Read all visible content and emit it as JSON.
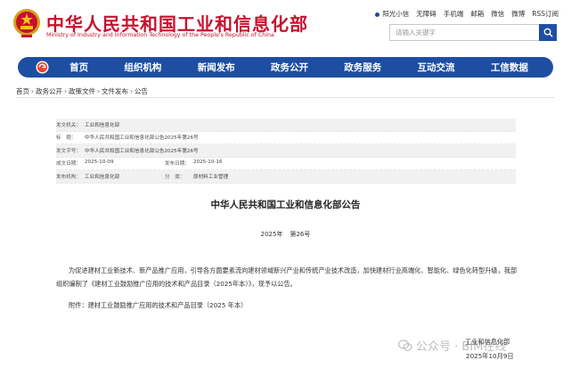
{
  "header": {
    "title_cn": "中华人民共和国工业和信息化部",
    "title_en": "Ministry of Industry and Information Technology of the People's Republic of China",
    "toplinks": [
      "阳光小信",
      "无障碍",
      "手机端",
      "邮箱",
      "微信",
      "微博",
      "RSS订阅"
    ],
    "search_placeholder": "请输入关键字"
  },
  "nav": {
    "items": [
      "首页",
      "组织机构",
      "新闻发布",
      "政务公开",
      "政务服务",
      "互动交流",
      "工信数据"
    ]
  },
  "breadcrumb": [
    "首页",
    "政务公开",
    "政策文件",
    "文件发布",
    "公告"
  ],
  "meta": {
    "issuer_label": "发文机关：",
    "issuer": "工业和信息化部",
    "title_label": "标　题：",
    "title": "中华人民共和国工业和信息化部公告2025年第26号",
    "docno_label": "发文字号：",
    "docno": "中华人民共和国工业和信息化部公告2025年第26号",
    "created_label": "成文日期：",
    "created": "2025-10-09",
    "published_label": "发布日期：",
    "published": "2025-10-16",
    "agency_label": "发布机构：",
    "agency": "工业和信息化部",
    "category_label": "分　类：",
    "category": "原材料工业管理"
  },
  "document": {
    "title": "中华人民共和国工业和信息化部公告",
    "year": "2025年",
    "number": "第26号",
    "paragraph": "为促进建材工业新技术、新产品推广应用，引导各方面要素流向建材领域新兴产业和传统产业技术改造，加快建材行业高端化、智能化、绿色化转型升级，我部组织编制了《建材工业鼓励推广应用的技术和产品目录（2025年本）》，现予以公告。",
    "attachment": "附件：建材工业鼓励推广应用的技术和产品目录（2025 年本）",
    "signature": "工业和信息化部",
    "date": "2025年10月9日"
  },
  "watermark": {
    "text": "公众号 · BIM在线"
  },
  "colors": {
    "brand_red": "#c8102e",
    "nav_blue": "#1e4ea1"
  }
}
